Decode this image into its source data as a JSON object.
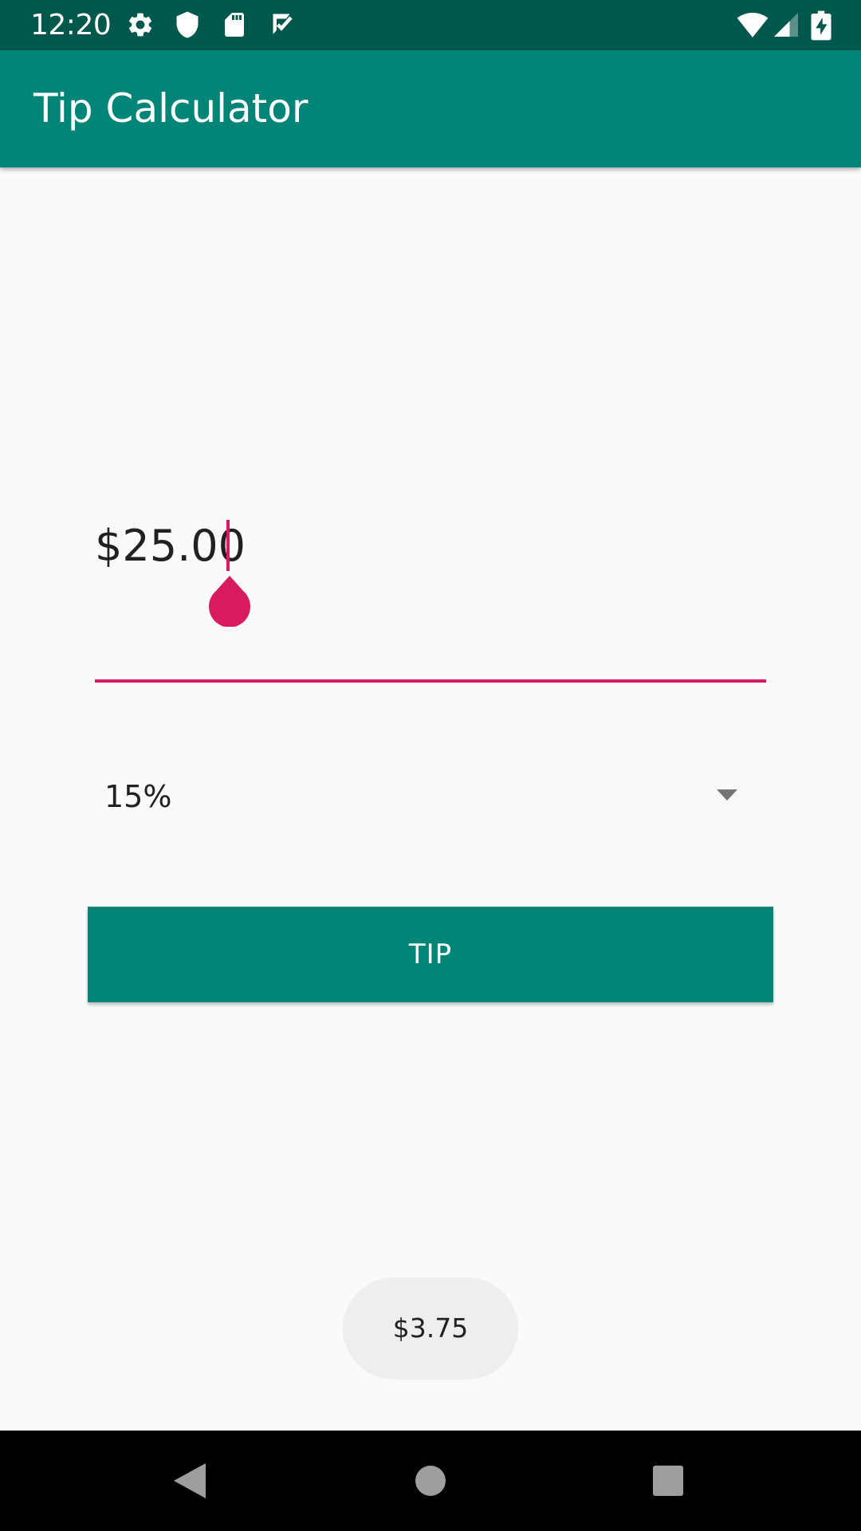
{
  "status_bar": {
    "time": "12:20",
    "icons_left": [
      "gear-icon",
      "shield-icon",
      "sd-card-icon",
      "checkbox-icon"
    ],
    "icons_right": [
      "wifi-icon",
      "signal-icon",
      "battery-charging-icon"
    ]
  },
  "app_bar": {
    "title": "Tip Calculator"
  },
  "bill_amount": {
    "value": "$25.00",
    "accent_color": "#d81b60"
  },
  "tip_percent": {
    "selected": "15%",
    "icon": "dropdown-arrow-icon"
  },
  "tip_button": {
    "label": "TIP"
  },
  "toast": {
    "message": "$3.75"
  },
  "nav_bar": {
    "buttons": [
      "back-icon",
      "home-icon",
      "recents-icon"
    ]
  },
  "colors": {
    "primary": "#008577",
    "primary_dark": "#00574b",
    "accent": "#d81b60",
    "background": "#fafafa"
  }
}
